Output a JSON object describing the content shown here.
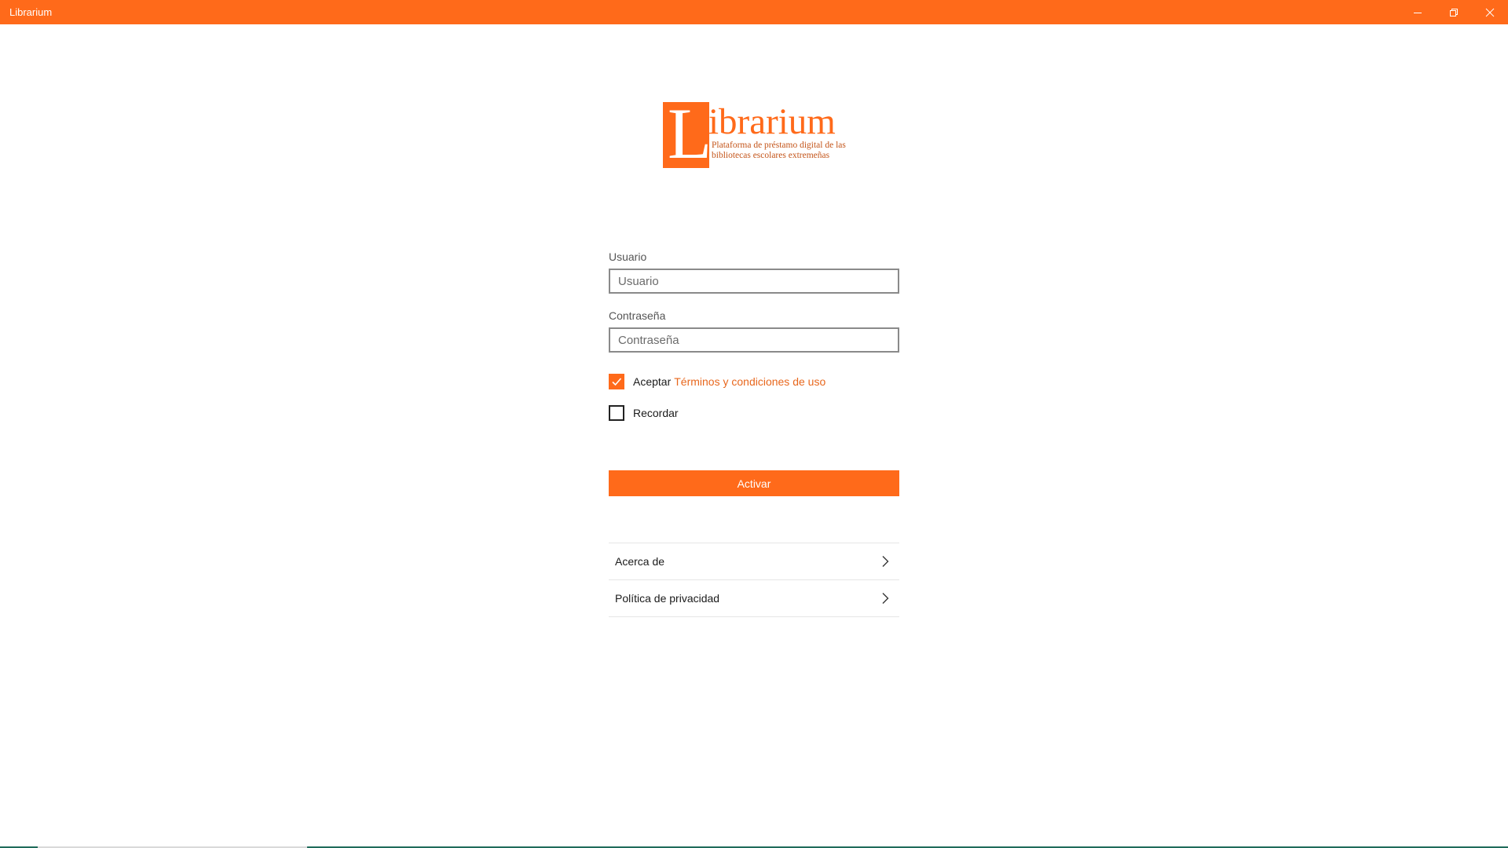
{
  "window": {
    "title": "Librarium",
    "accent_color": "#ff6a1a",
    "controls": {
      "minimize_icon": "minimize-icon",
      "maximize_icon": "restore-icon",
      "close_icon": "close-icon"
    }
  },
  "logo": {
    "letter": "L",
    "rest": "ibrarium",
    "tagline": "Plataforma de préstamo digital de las bibliotecas escolares extremeñas"
  },
  "form": {
    "username": {
      "label": "Usuario",
      "placeholder": "Usuario",
      "value": ""
    },
    "password": {
      "label": "Contraseña",
      "placeholder": "Contraseña",
      "value": ""
    },
    "accept_terms": {
      "label": "Aceptar",
      "link_text": "Términos y condiciones de uso",
      "checked": true
    },
    "remember": {
      "label": "Recordar",
      "checked": false
    },
    "submit_label": "Activar"
  },
  "nav": {
    "items": [
      {
        "label": "Acerca de",
        "icon": "chevron-right-icon"
      },
      {
        "label": "Política de privacidad",
        "icon": "chevron-right-icon"
      }
    ]
  }
}
